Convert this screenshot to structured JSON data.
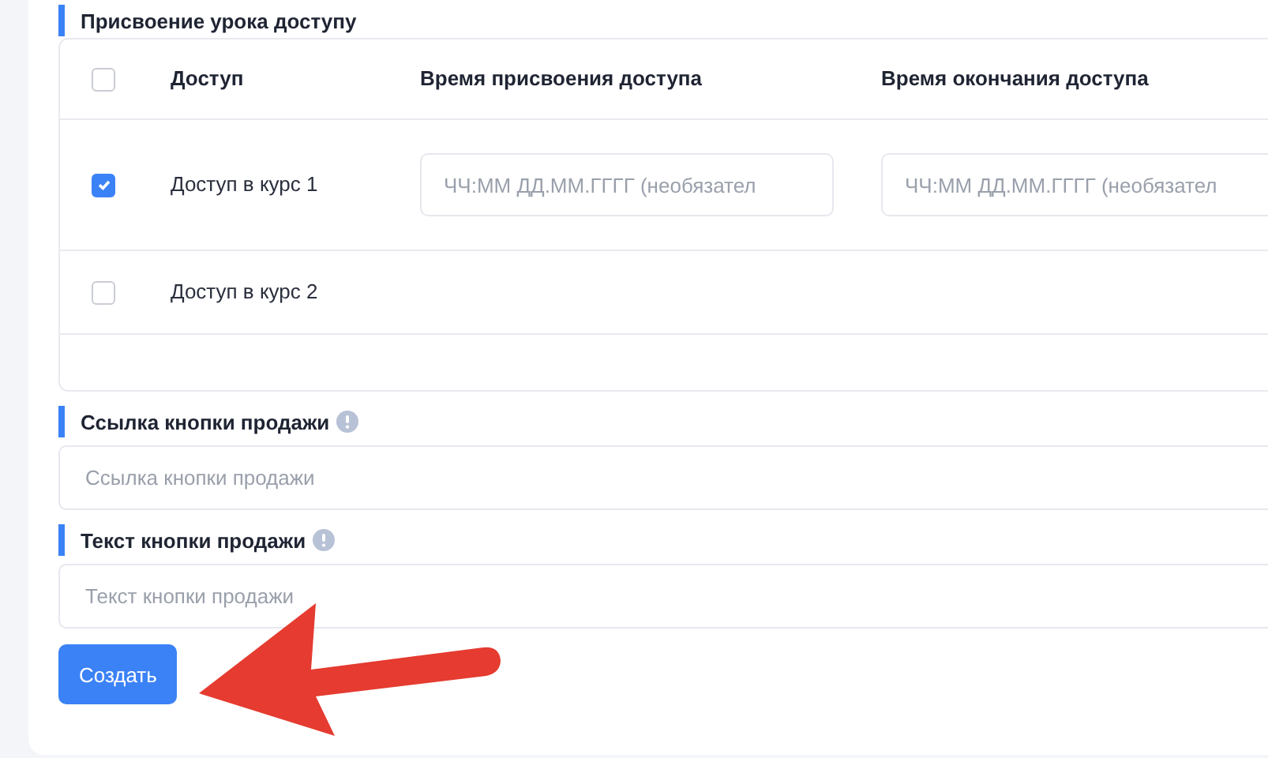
{
  "section_title": "Присвоение урока доступу",
  "access_table": {
    "select_all": {
      "checked": false
    },
    "columns": [
      "Доступ",
      "Время присвоения доступа",
      "Время окончания доступа"
    ],
    "rows": [
      {
        "checked": true,
        "label": "Доступ в курс 1",
        "start": {
          "placeholder": "ЧЧ:ММ ДД.ММ.ГГГГ (необязател"
        },
        "end": {
          "placeholder": "ЧЧ:ММ ДД.ММ.ГГГГ (необязател"
        }
      },
      {
        "checked": false,
        "label": "Доступ в курс 2"
      }
    ]
  },
  "fields": [
    {
      "label": "Ссылка кнопки продажи",
      "placeholder": "Ссылка кнопки продажи"
    },
    {
      "label": "Текст кнопки продажи",
      "placeholder": "Текст кнопки продажи"
    }
  ],
  "submit_button": "Создать"
}
